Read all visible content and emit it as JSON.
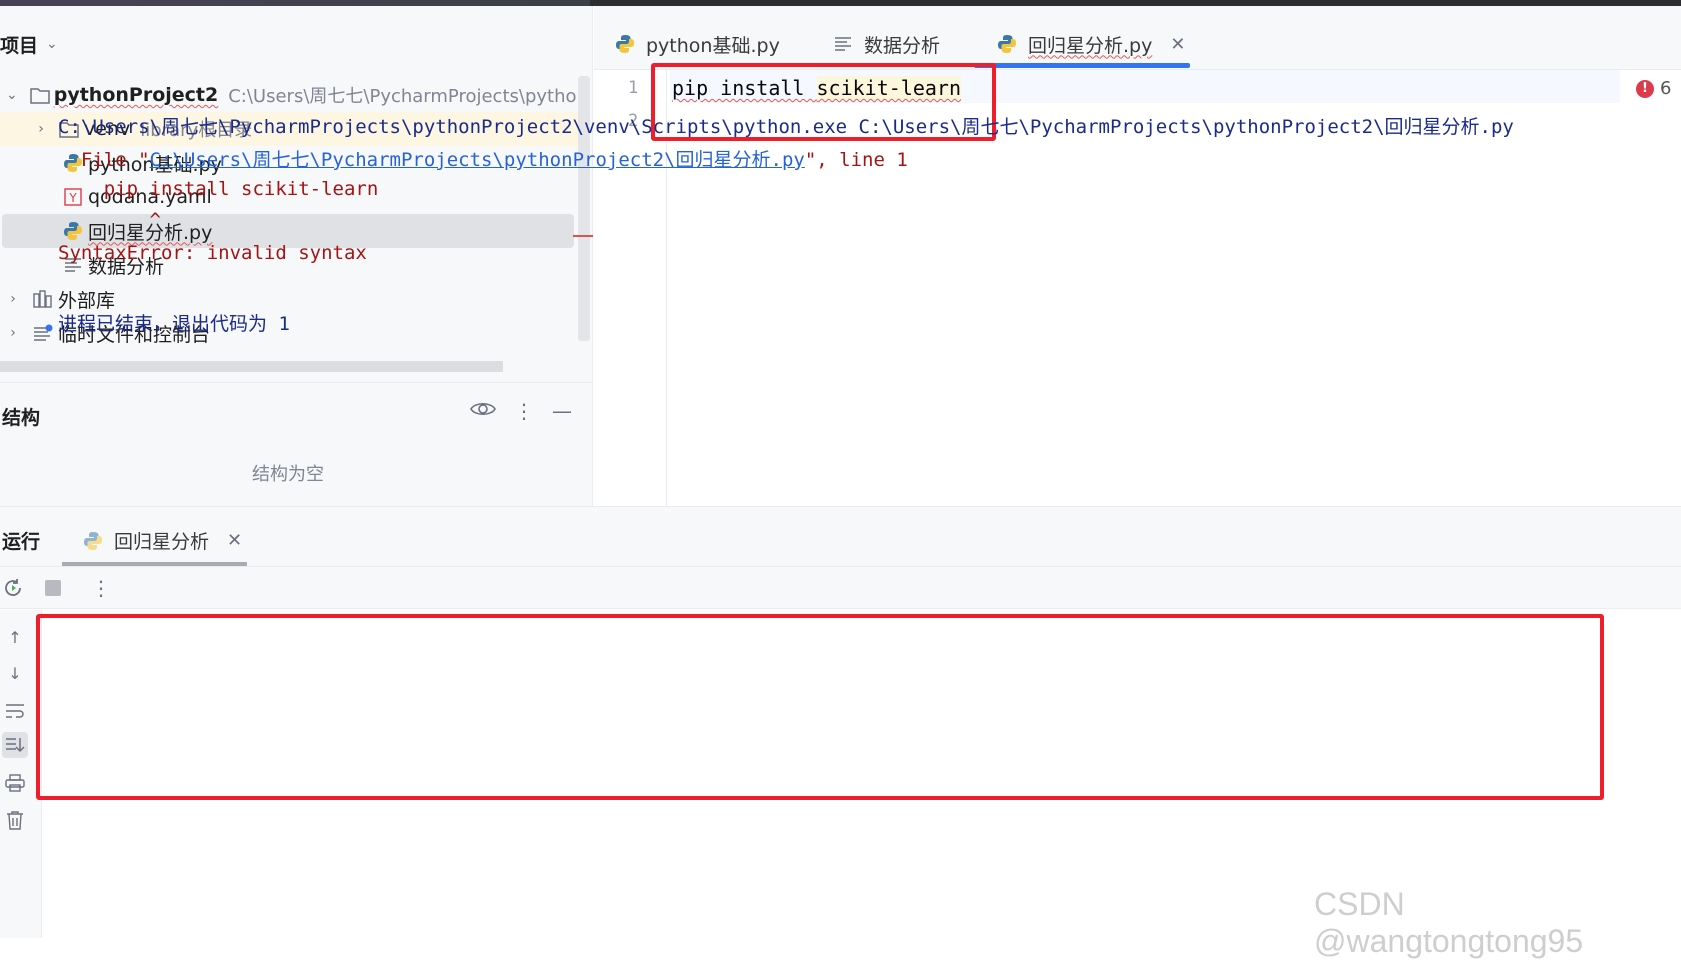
{
  "project_panel": {
    "title": "项目",
    "tree": {
      "root_name": "pythonProject2",
      "root_path": "C:\\Users\\周七七\\PycharmProjects\\pythonProj",
      "venv_name": "venv",
      "venv_note": "library根目录",
      "file1": "python基础.py",
      "file2": "qodana.yaml",
      "file3": "回归星分析.py",
      "file4": "数据分析",
      "ext_libs": "外部库",
      "scratches": "临时文件和控制台"
    }
  },
  "structure_panel": {
    "title": "结构",
    "empty_text": "结构为空"
  },
  "editor": {
    "tabs": [
      "python基础.py",
      "数据分析",
      "回归星分析.py"
    ],
    "active_tab_index": 2,
    "line_numbers": [
      "1",
      "2"
    ],
    "code_line1_a": "pip install ",
    "code_line1_b": "scikit-learn",
    "error_count": "6"
  },
  "run_panel": {
    "title": "运行",
    "tab_label": "回归星分析",
    "console": {
      "line1": "C:\\Users\\周七七\\PycharmProjects\\pythonProject2\\venv\\Scripts\\python.exe C:\\Users\\周七七\\PycharmProjects\\pythonProject2\\回归星分析.py",
      "line2_prefix": "  File \"",
      "line2_link": "C:\\Users\\周七七\\PycharmProjects\\pythonProject2\\回归星分析.py",
      "line2_suffix": "\", line 1",
      "line3": "    pip install scikit-learn",
      "line4": "        ^",
      "line5": "SyntaxError: invalid syntax",
      "exit_line": "进程已结束，退出代码为 1"
    }
  },
  "watermark": "CSDN @wangtongtong95",
  "colors": {
    "accent": "#3574f0",
    "highlight_box": "#ee1f2a",
    "error_text": "#a31515",
    "command_text": "#1a2b8c"
  }
}
